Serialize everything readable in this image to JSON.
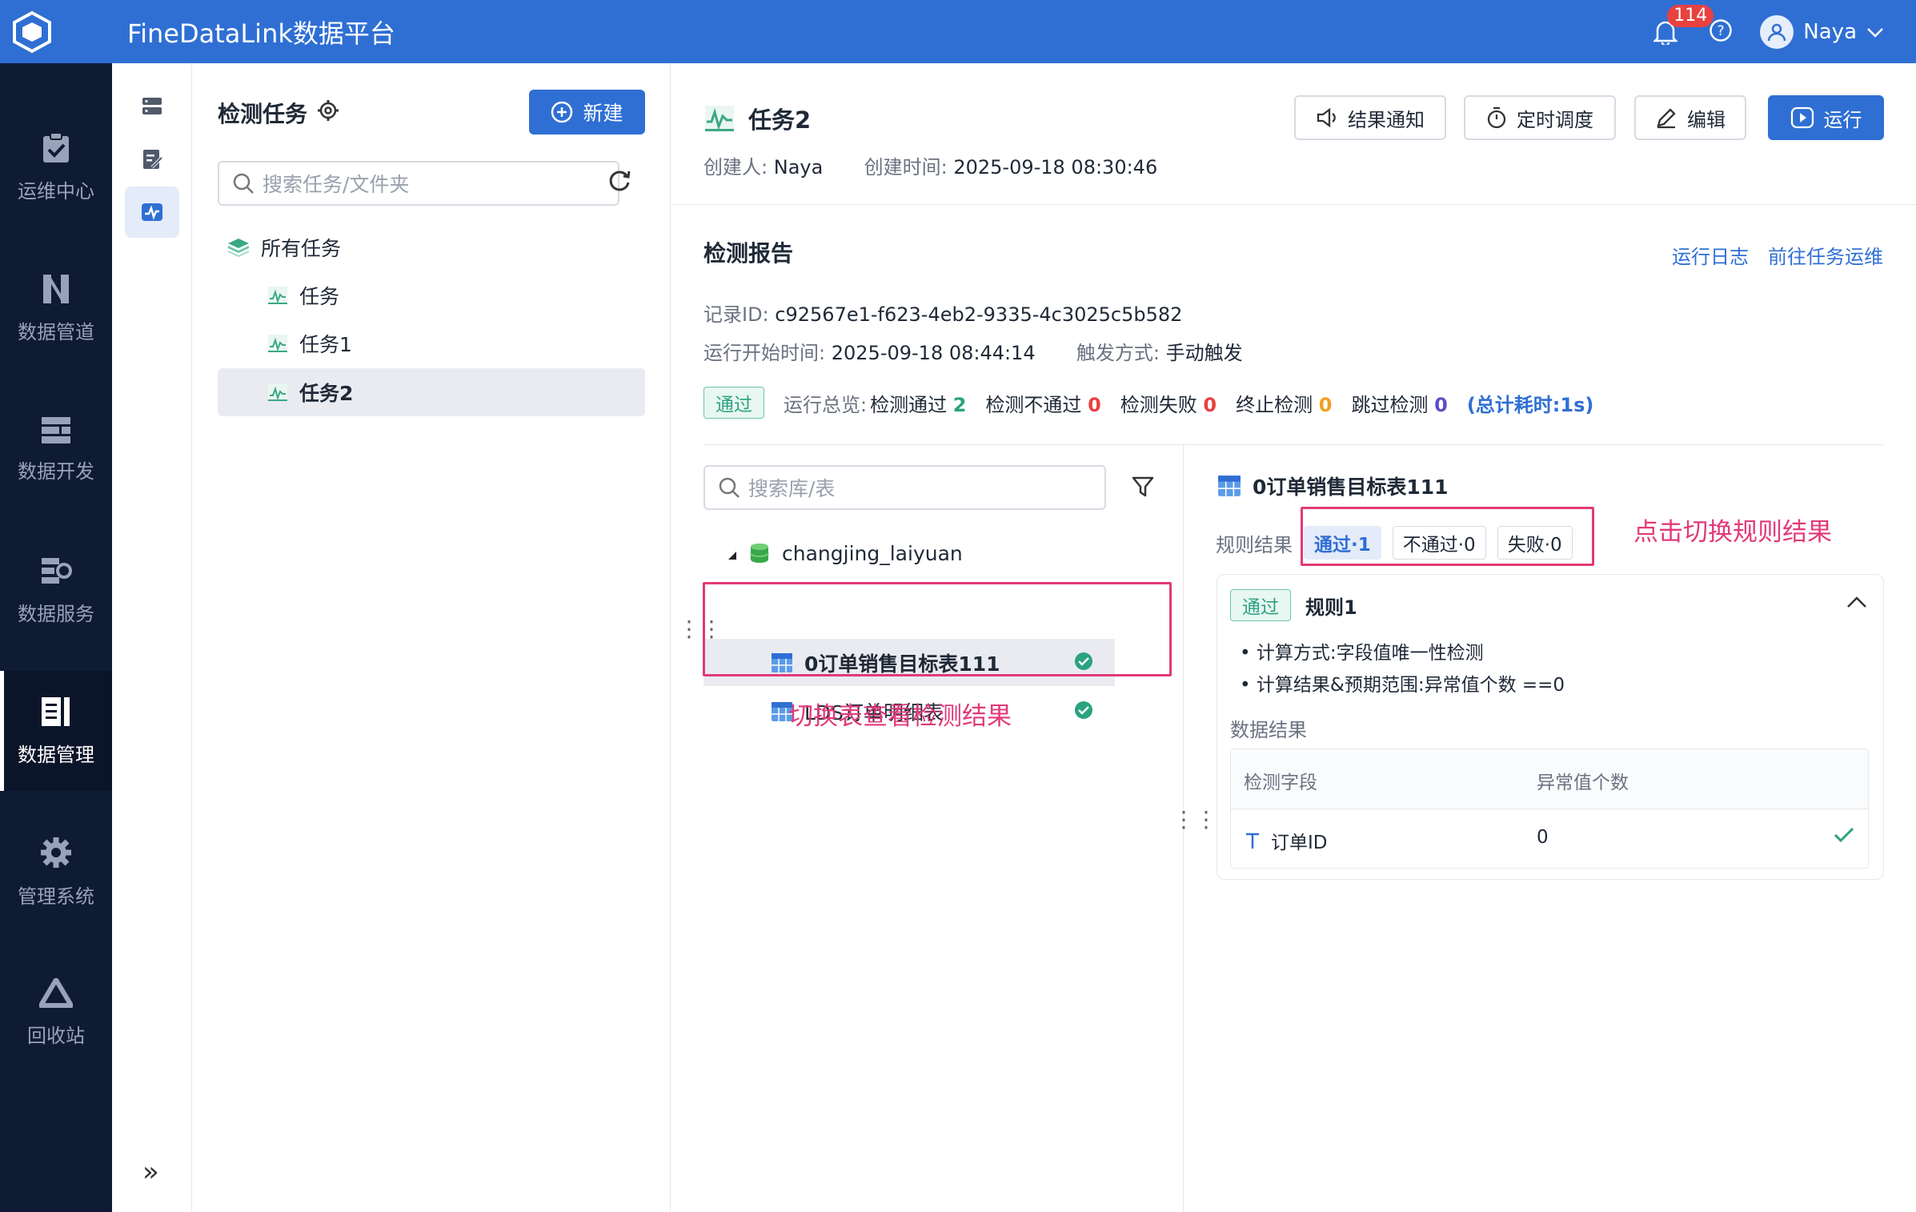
{
  "app": {
    "title": "FineDataLink数据平台",
    "notification_count": "114",
    "user_name": "Naya"
  },
  "left_nav": [
    {
      "label": "运维中心",
      "icon": "clipboard-check-icon"
    },
    {
      "label": "数据管道",
      "icon": "pipeline-icon"
    },
    {
      "label": "数据开发",
      "icon": "develop-icon"
    },
    {
      "label": "数据服务",
      "icon": "service-icon"
    },
    {
      "label": "数据管理",
      "icon": "data-management-icon",
      "active": true
    },
    {
      "label": "管理系统",
      "icon": "gear-icon"
    },
    {
      "label": "回收站",
      "icon": "recycle-icon"
    }
  ],
  "task_panel": {
    "title": "检测任务",
    "new_label": "新建",
    "search_placeholder": "搜索任务/文件夹",
    "root_label": "所有任务",
    "tasks": [
      "任务",
      "任务1",
      "任务2"
    ],
    "selected_task": "任务2"
  },
  "task": {
    "name": "任务2",
    "creator_label": "创建人:",
    "creator": "Naya",
    "created_label": "创建时间:",
    "created": "2025-09-18 08:30:46",
    "buttons": {
      "notify": "结果通知",
      "schedule": "定时调度",
      "edit": "编辑",
      "run": "运行"
    }
  },
  "report": {
    "title": "检测报告",
    "run_log": "运行日志",
    "goto_ops": "前往任务运维",
    "record_label": "记录ID:",
    "record_id": "c92567e1-f623-4eb2-9335-4c3025c5b582",
    "start_label": "运行开始时间:",
    "start_time": "2025-09-18 08:44:14",
    "trigger_label": "触发方式:",
    "trigger": "手动触发",
    "status_tag": "通过",
    "summary_label": "运行总览:",
    "pass_label": "检测通过",
    "pass_count": "2",
    "fail_label": "检测不通过",
    "fail_count": "0",
    "error_label": "检测失败",
    "error_count": "0",
    "stop_label": "终止检测",
    "stop_count": "0",
    "skip_label": "跳过检测",
    "skip_count": "0",
    "total_time": "(总计耗时:1s)"
  },
  "tables_panel": {
    "search_placeholder": "搜索库/表",
    "database": "changjing_laiyuan",
    "tables": [
      "0订单销售目标表111",
      "LDS订单明细表"
    ],
    "annotation": "切换表查看检测结果"
  },
  "detail": {
    "table_name": "0订单销售目标表111",
    "rule_result_label": "规则结果",
    "chips": [
      "通过·1",
      "不通过·0",
      "失败·0"
    ],
    "annotation": "点击切换规则结果",
    "rule_tag": "通过",
    "rule_name": "规则1",
    "calc_method": "计算方式:字段值唯一性检测",
    "calc_result": "计算结果&预期范围:异常值个数 ==0",
    "data_result_label": "数据结果",
    "columns": [
      "检测字段",
      "异常值个数"
    ],
    "rows": [
      {
        "field": "订单ID",
        "count": "0"
      }
    ]
  },
  "colors": {
    "brand": "#2f6fd4",
    "nav_bg": "#0f1b33",
    "pass": "#2aa37f",
    "fail": "#e8413f",
    "annotation": "#e23a78"
  }
}
